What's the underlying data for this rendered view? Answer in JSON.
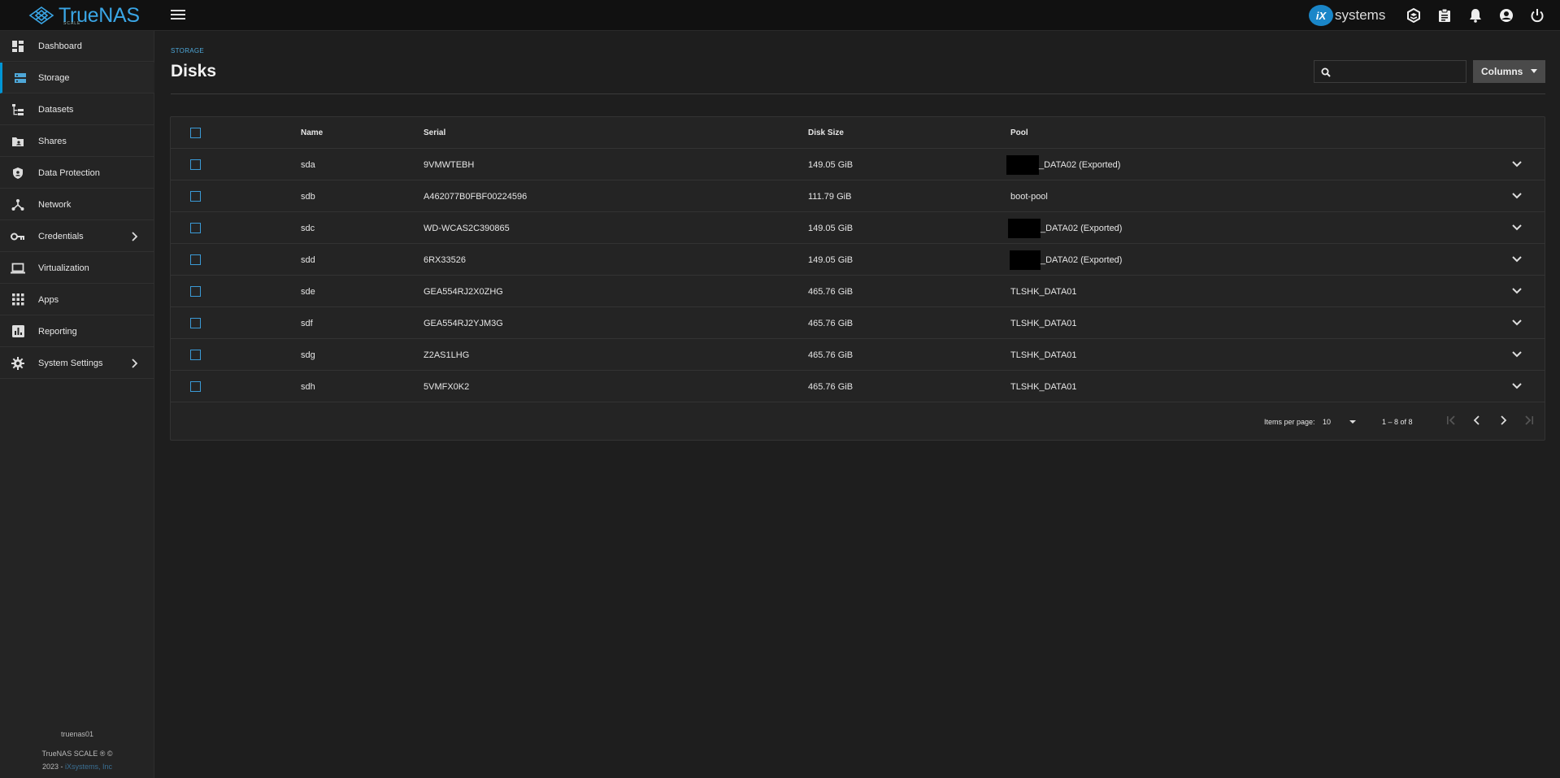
{
  "header": {
    "logo_text": "TrueNAS",
    "logo_sub": "SCALE",
    "brand_ix": "iX",
    "brand_systems": "systems"
  },
  "sidebar": {
    "items": [
      {
        "label": "Dashboard",
        "icon": "dashboard-icon"
      },
      {
        "label": "Storage",
        "icon": "storage-icon"
      },
      {
        "label": "Datasets",
        "icon": "datasets-icon"
      },
      {
        "label": "Shares",
        "icon": "shares-icon"
      },
      {
        "label": "Data Protection",
        "icon": "shield-icon"
      },
      {
        "label": "Network",
        "icon": "network-icon"
      },
      {
        "label": "Credentials",
        "icon": "key-icon"
      },
      {
        "label": "Virtualization",
        "icon": "laptop-icon"
      },
      {
        "label": "Apps",
        "icon": "apps-grid-icon"
      },
      {
        "label": "Reporting",
        "icon": "reporting-icon"
      },
      {
        "label": "System Settings",
        "icon": "gear-icon"
      }
    ],
    "hostname": "truenas01",
    "footer_line1": "TrueNAS SCALE ® ©",
    "footer_year": "2023 -",
    "footer_link": "iXsystems, Inc"
  },
  "main": {
    "breadcrumb": "STORAGE",
    "title": "Disks",
    "search_placeholder": "",
    "columns_button": "Columns"
  },
  "table": {
    "headers": {
      "name": "Name",
      "serial": "Serial",
      "size": "Disk Size",
      "pool": "Pool"
    },
    "rows": [
      {
        "name": "sda",
        "serial": "9VMWTEBH",
        "size": "149.05 GiB",
        "pool": "_DATA02 (Exported)",
        "redacted": true
      },
      {
        "name": "sdb",
        "serial": "A462077B0FBF00224596",
        "size": "111.79 GiB",
        "pool": "boot-pool",
        "redacted": false
      },
      {
        "name": "sdc",
        "serial": "WD-WCAS2C390865",
        "size": "149.05 GiB",
        "pool": "_DATA02 (Exported)",
        "redacted": true
      },
      {
        "name": "sdd",
        "serial": "6RX33526",
        "size": "149.05 GiB",
        "pool": "_DATA02 (Exported)",
        "redacted": true
      },
      {
        "name": "sde",
        "serial": "GEA554RJ2X0ZHG",
        "size": "465.76 GiB",
        "pool": "TLSHK_DATA01",
        "redacted": false
      },
      {
        "name": "sdf",
        "serial": "GEA554RJ2YJM3G",
        "size": "465.76 GiB",
        "pool": "TLSHK_DATA01",
        "redacted": false
      },
      {
        "name": "sdg",
        "serial": "Z2AS1LHG",
        "size": "465.76 GiB",
        "pool": "TLSHK_DATA01",
        "redacted": false
      },
      {
        "name": "sdh",
        "serial": "5VMFX0K2",
        "size": "465.76 GiB",
        "pool": "TLSHK_DATA01",
        "redacted": false
      }
    ]
  },
  "pager": {
    "items_per_page_label": "Items per page:",
    "items_per_page_value": "10",
    "range": "1 – 8 of 8"
  },
  "colors": {
    "accent": "#0095d5",
    "background": "#1e1e1e",
    "topbar": "#111111"
  }
}
